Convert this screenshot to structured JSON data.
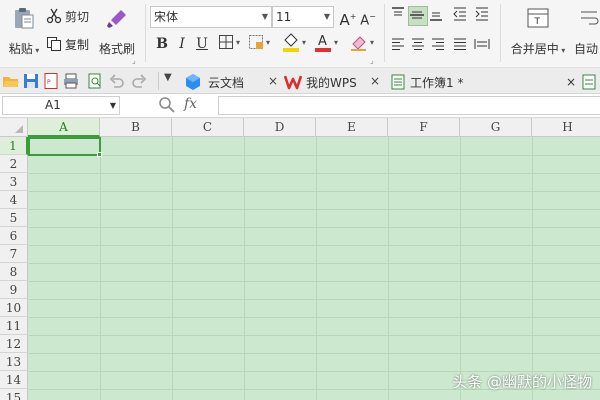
{
  "ribbon": {
    "paste_label": "粘贴",
    "cut_label": "剪切",
    "copy_label": "复制",
    "format_painter_label": "格式刷",
    "font_name": "宋体",
    "font_size": "11",
    "bold": "B",
    "italic": "I",
    "underline": "U",
    "merge_center_label": "合并居中",
    "auto_wrap_label": "自动"
  },
  "tabs": [
    {
      "label": "云文档"
    },
    {
      "label": "我的WPS"
    },
    {
      "label": "工作簿1 *"
    }
  ],
  "formula_bar": {
    "cell_ref": "A1",
    "fx_label": "fx",
    "value": ""
  },
  "grid": {
    "columns": [
      "A",
      "B",
      "C",
      "D",
      "E",
      "F",
      "G",
      "H"
    ],
    "rows": [
      "1",
      "2",
      "3",
      "4",
      "5",
      "6",
      "7",
      "8",
      "9",
      "10",
      "11",
      "12",
      "13",
      "14",
      "15"
    ],
    "selected_cell": "A1"
  },
  "watermark": "头条 @幽默的小怪物",
  "colors": {
    "grid_background": "#cce8cf",
    "selection": "#3c9c3c",
    "wps_red": "#d9302b",
    "font_color_red": "#e03030",
    "highlight_yellow": "#f5d300"
  }
}
